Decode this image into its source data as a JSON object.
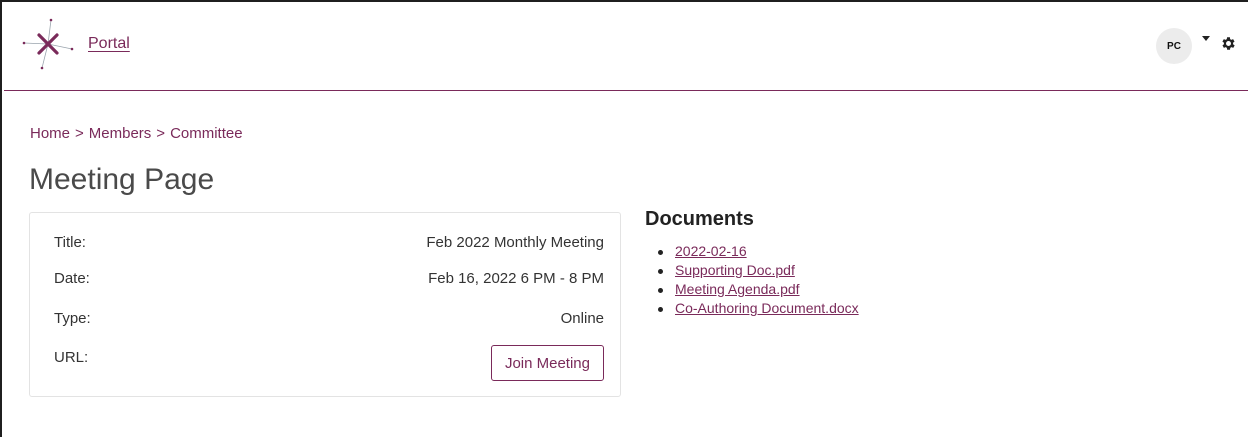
{
  "header": {
    "logo_icon": "starburst-logo-icon",
    "portal_link": "Portal",
    "user_initials": "PC",
    "dropdown_icon": "caret-down-icon",
    "settings_icon": "gear-icon"
  },
  "breadcrumb": {
    "items": [
      "Home",
      "Members",
      "Committee"
    ],
    "separator": ">"
  },
  "page": {
    "title": "Meeting Page"
  },
  "meeting": {
    "rows": [
      {
        "label": "Title:",
        "value": "Feb 2022 Monthly Meeting"
      },
      {
        "label": "Date:",
        "value": "Feb 16, 2022 6 PM - 8 PM"
      },
      {
        "label": "Type:",
        "value": "Online"
      },
      {
        "label": "URL:",
        "value": ""
      }
    ],
    "join_button": "Join Meeting"
  },
  "documents": {
    "title": "Documents",
    "items": [
      "2022-02-16",
      "Supporting Doc.pdf",
      "Meeting Agenda.pdf",
      "Co-Authoring Document.docx"
    ]
  },
  "colors": {
    "accent": "#7a2a5a",
    "border": "#e3e3e3"
  }
}
